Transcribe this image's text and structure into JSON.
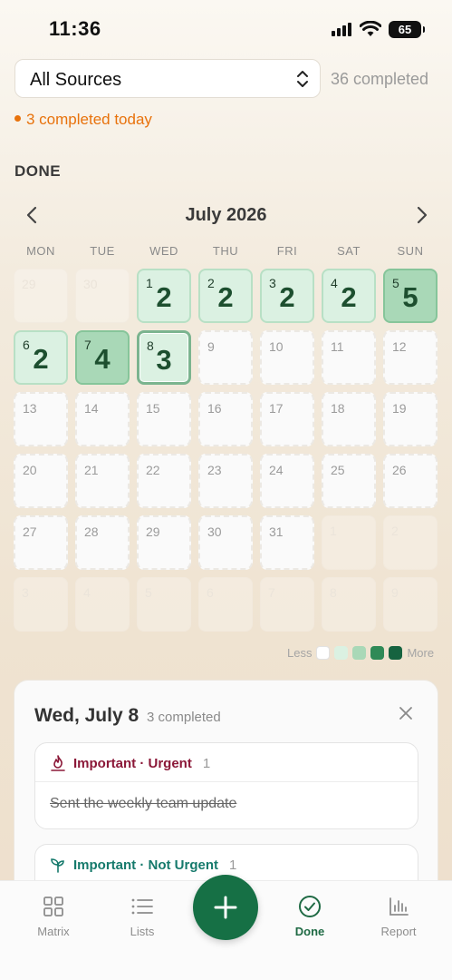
{
  "status_bar": {
    "time": "11:36",
    "battery": "65"
  },
  "source_selector": {
    "value": "All Sources"
  },
  "completed_total": "36 completed",
  "completed_today": "3 completed today",
  "section_title": "DONE",
  "calendar": {
    "month_title": "July 2026",
    "weekdays": [
      "MON",
      "TUE",
      "WED",
      "THU",
      "FRI",
      "SAT",
      "SUN"
    ],
    "rows": [
      [
        {
          "day": "29",
          "count": "",
          "state": "muted"
        },
        {
          "day": "30",
          "count": "",
          "state": "muted"
        },
        {
          "day": "1",
          "count": "2",
          "state": "l1"
        },
        {
          "day": "2",
          "count": "2",
          "state": "l1"
        },
        {
          "day": "3",
          "count": "2",
          "state": "l1"
        },
        {
          "day": "4",
          "count": "2",
          "state": "l1"
        },
        {
          "day": "5",
          "count": "5",
          "state": "l2"
        }
      ],
      [
        {
          "day": "6",
          "count": "2",
          "state": "l1"
        },
        {
          "day": "7",
          "count": "4",
          "state": "l2"
        },
        {
          "day": "8",
          "count": "3",
          "state": "today-cell"
        },
        {
          "day": "9",
          "count": "",
          "state": "empty"
        },
        {
          "day": "10",
          "count": "",
          "state": "empty"
        },
        {
          "day": "11",
          "count": "",
          "state": "empty"
        },
        {
          "day": "12",
          "count": "",
          "state": "empty"
        }
      ],
      [
        {
          "day": "13",
          "count": "",
          "state": "empty"
        },
        {
          "day": "14",
          "count": "",
          "state": "empty"
        },
        {
          "day": "15",
          "count": "",
          "state": "empty"
        },
        {
          "day": "16",
          "count": "",
          "state": "empty"
        },
        {
          "day": "17",
          "count": "",
          "state": "empty"
        },
        {
          "day": "18",
          "count": "",
          "state": "empty"
        },
        {
          "day": "19",
          "count": "",
          "state": "empty"
        }
      ],
      [
        {
          "day": "20",
          "count": "",
          "state": "empty"
        },
        {
          "day": "21",
          "count": "",
          "state": "empty"
        },
        {
          "day": "22",
          "count": "",
          "state": "empty"
        },
        {
          "day": "23",
          "count": "",
          "state": "empty"
        },
        {
          "day": "24",
          "count": "",
          "state": "empty"
        },
        {
          "day": "25",
          "count": "",
          "state": "empty"
        },
        {
          "day": "26",
          "count": "",
          "state": "empty"
        }
      ],
      [
        {
          "day": "27",
          "count": "",
          "state": "empty"
        },
        {
          "day": "28",
          "count": "",
          "state": "empty"
        },
        {
          "day": "29",
          "count": "",
          "state": "empty"
        },
        {
          "day": "30",
          "count": "",
          "state": "empty"
        },
        {
          "day": "31",
          "count": "",
          "state": "empty"
        },
        {
          "day": "1",
          "count": "",
          "state": "muted"
        },
        {
          "day": "2",
          "count": "",
          "state": "muted"
        }
      ],
      [
        {
          "day": "3",
          "count": "",
          "state": "muted"
        },
        {
          "day": "4",
          "count": "",
          "state": "muted"
        },
        {
          "day": "5",
          "count": "",
          "state": "muted"
        },
        {
          "day": "6",
          "count": "",
          "state": "muted"
        },
        {
          "day": "7",
          "count": "",
          "state": "muted"
        },
        {
          "day": "8",
          "count": "",
          "state": "muted"
        },
        {
          "day": "9",
          "count": "",
          "state": "muted"
        }
      ]
    ],
    "legend": {
      "less": "Less",
      "more": "More",
      "colors": [
        "#ffffff",
        "#dbf1e2",
        "#a9d8b7",
        "#2f8a57",
        "#166340"
      ]
    }
  },
  "detail": {
    "title": "Wed, July 8",
    "subtitle": "3 completed",
    "groups": [
      {
        "label": "Important · Urgent",
        "count": "1",
        "color": "#8b1838",
        "icon": "fire-icon",
        "task": "Sent the weekly team update"
      },
      {
        "label": "Important · Not Urgent",
        "count": "1",
        "color": "#167a6c",
        "icon": "sprout-icon",
        "task": ""
      }
    ]
  },
  "nav": {
    "items": [
      {
        "label": "Matrix",
        "icon": "grid-icon"
      },
      {
        "label": "Lists",
        "icon": "list-icon"
      },
      {
        "label": "Done",
        "icon": "check-circle-icon"
      },
      {
        "label": "Report",
        "icon": "bar-chart-icon"
      }
    ],
    "active": "Done",
    "fab_icon": "plus-icon"
  }
}
